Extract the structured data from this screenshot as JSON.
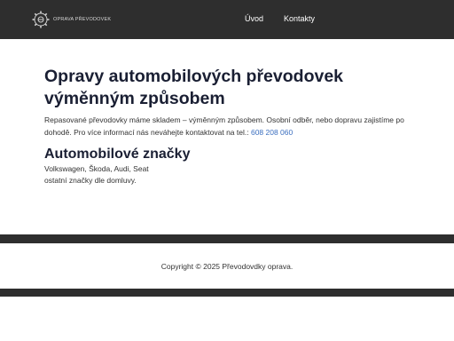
{
  "header": {
    "logo_text": "OPRAVA PŘEVODOVEK",
    "logo_icon": "gear-icon",
    "nav": [
      {
        "label": "Úvod"
      },
      {
        "label": "Kontakty"
      }
    ]
  },
  "main": {
    "title": "Opravy automobilových převodovek výměnným způsobem",
    "intro_text": "Repasované převodovky máme skladem – výměnným způsobem. Osobní odběr, nebo dopravu zajistíme po dohodě. Pro více informací nás neváhejte kontaktovat na tel.:",
    "phone": "608 208 060",
    "brands_title": "Automobilové značky",
    "brands_line1": "Volkswagen, Škoda, Audi, Seat",
    "brands_line2": "ostatní značky dle domluvy."
  },
  "footer": {
    "copyright": "Copyright © 2025 Převodovdky oprava."
  },
  "colors": {
    "header_bg": "#2e2e2e",
    "link": "#3b6fbf",
    "heading": "#1a1f33"
  }
}
